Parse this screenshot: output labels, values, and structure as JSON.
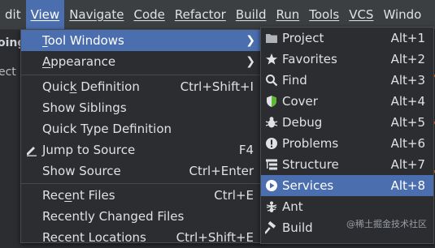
{
  "menubar": {
    "items": [
      "dit",
      "View",
      "Navigate",
      "Code",
      "Refactor",
      "Build",
      "Run",
      "Tools",
      "VCS",
      "Windo"
    ],
    "active_index": 1
  },
  "background": {
    "left_bold": "oing",
    "left_text": "ect"
  },
  "view_menu": {
    "items": [
      {
        "label": "Tool Windows",
        "mn": "T",
        "rest": "ool Windows",
        "submenu": true,
        "selected": true
      },
      {
        "label": "Appearance",
        "mn": "A",
        "rest": "ppearance",
        "submenu": true
      },
      {
        "separator": true
      },
      {
        "label": "Quick Definition",
        "pre": "Quic",
        "mn": "k",
        "rest": " Definition",
        "shortcut": "Ctrl+Shift+I"
      },
      {
        "label": "Show Siblings"
      },
      {
        "label": "Quick Type Definition"
      },
      {
        "label": "Jump to Source",
        "icon": "pencil-icon",
        "shortcut": "F4"
      },
      {
        "label": "Show Source",
        "shortcut": "Ctrl+Enter"
      },
      {
        "separator": true
      },
      {
        "label": "Recent Files",
        "pre": "Rec",
        "mn": "e",
        "rest": "nt Files",
        "shortcut": "Ctrl+E"
      },
      {
        "label": "Recently Changed Files"
      },
      {
        "label": "Recent Locations",
        "shortcut": "Ctrl+Shift+E"
      }
    ]
  },
  "tool_windows_menu": {
    "items": [
      {
        "label": "Project",
        "icon": "folder-icon",
        "shortcut": "Alt+1"
      },
      {
        "label": "Favorites",
        "icon": "star-icon",
        "shortcut": "Alt+2"
      },
      {
        "label": "Find",
        "icon": "search-icon",
        "shortcut": "Alt+3"
      },
      {
        "label": "Cover",
        "icon": "shield-icon",
        "shortcut": "Alt+4"
      },
      {
        "label": "Debug",
        "icon": "bug-icon",
        "shortcut": "Alt+5"
      },
      {
        "label": "Problems",
        "icon": "warning-circle-icon",
        "shortcut": "Alt+6"
      },
      {
        "label": "Structure",
        "icon": "structure-icon",
        "shortcut": "Alt+7"
      },
      {
        "label": "Services",
        "icon": "play-circle-icon",
        "shortcut": "Alt+8",
        "selected": true
      },
      {
        "label": "Ant",
        "icon": "ant-icon",
        "shortcut": ""
      },
      {
        "label": "Build",
        "icon": "hammer-icon",
        "shortcut": ""
      }
    ]
  },
  "watermark": "@稀土掘金技术社区",
  "colors": {
    "selection": "#4b6eaf",
    "menu_bg": "#2b2d30",
    "menubar_bg": "#3c3f41",
    "accent_stripe": "#d9733b"
  }
}
